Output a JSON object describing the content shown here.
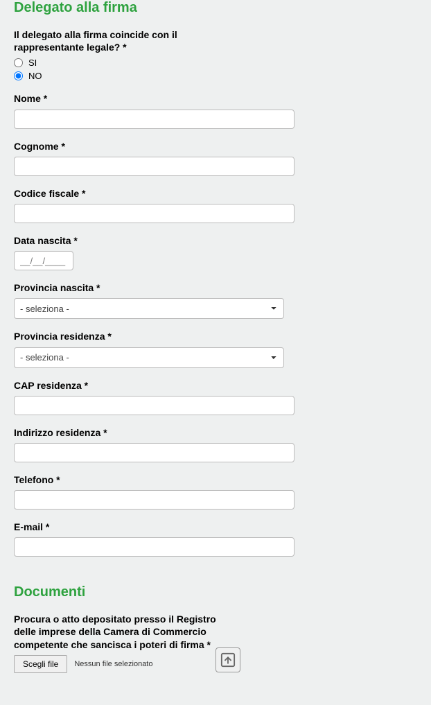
{
  "section1": {
    "title": "Delegato alla firma",
    "question": "Il delegato alla firma coincide con il rappresentante legale? *",
    "radio_si": "SI",
    "radio_no": "NO",
    "nome_label": "Nome *",
    "cognome_label": "Cognome *",
    "codice_fiscale_label": "Codice fiscale *",
    "data_nascita_label": "Data nascita *",
    "data_nascita_placeholder": "__/__/____",
    "provincia_nascita_label": "Provincia nascita *",
    "provincia_residenza_label": "Provincia residenza *",
    "select_placeholder": "- seleziona -",
    "cap_residenza_label": "CAP residenza *",
    "indirizzo_residenza_label": "Indirizzo residenza *",
    "telefono_label": "Telefono *",
    "email_label": "E-mail *"
  },
  "section2": {
    "title": "Documenti",
    "procura_label": "Procura o atto depositato presso il Registro delle imprese della Camera di Commercio competente che sancisca i poteri di firma *",
    "file_button": "Scegli file",
    "file_status": "Nessun file selezionato"
  }
}
